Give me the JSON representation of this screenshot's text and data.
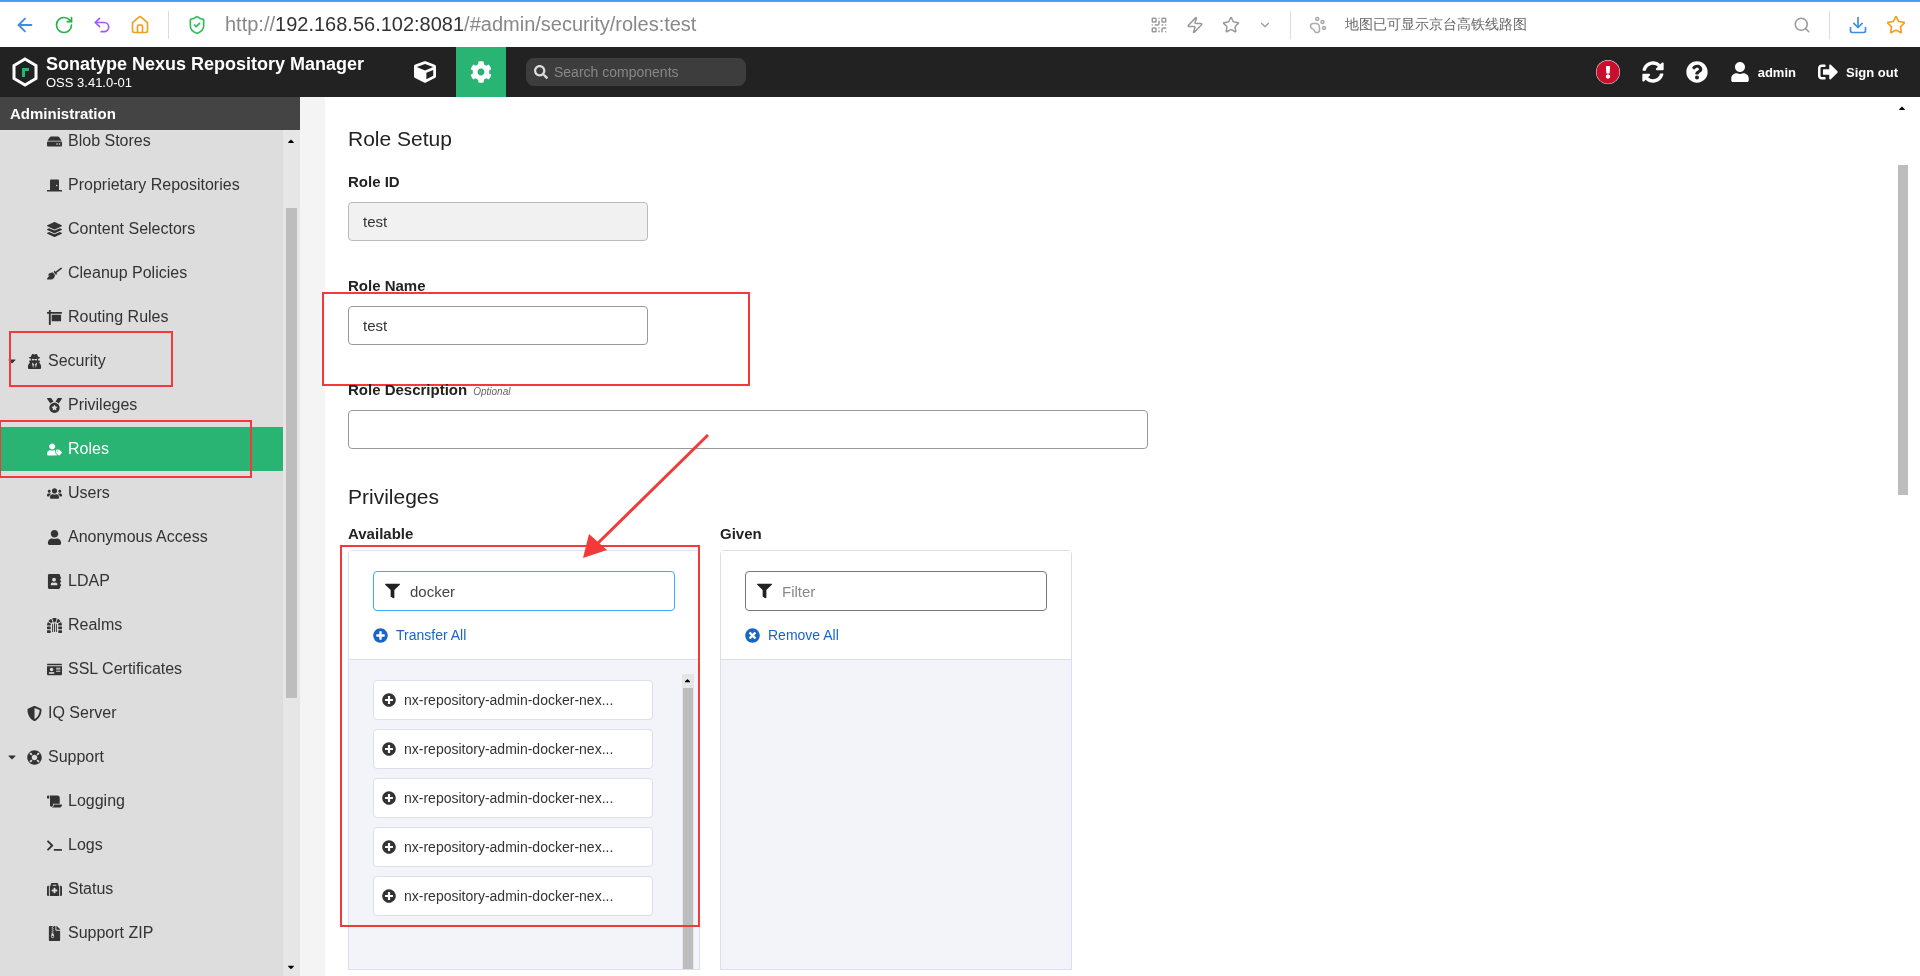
{
  "browser": {
    "url_scheme": "http://",
    "url_host": "192.168.56.102:8081",
    "url_path": "/#admin/security/roles:test",
    "news": "地图已可显示京台高铁线路图"
  },
  "header": {
    "product": "Sonatype Nexus Repository Manager",
    "version": "OSS 3.41.0-01",
    "modes": [
      {
        "kind": "browse",
        "selected": false
      },
      {
        "kind": "admin",
        "selected": true
      }
    ],
    "search_placeholder": "Search components",
    "user": "admin",
    "signout": "Sign out"
  },
  "sidebar": {
    "title": "Administration",
    "sections": [
      {
        "children": [
          {
            "label": "Blob Stores",
            "selected": false,
            "highlighted": false
          },
          {
            "label": "Proprietary Repositories",
            "selected": false,
            "highlighted": false
          },
          {
            "label": "Content Selectors",
            "selected": false,
            "highlighted": false
          },
          {
            "label": "Cleanup Policies",
            "selected": false,
            "highlighted": false
          },
          {
            "label": "Routing Rules",
            "selected": false,
            "highlighted": false
          }
        ]
      },
      {
        "label": "Security",
        "expanded": true,
        "selected": false,
        "highlighted": true,
        "children": [
          {
            "label": "Privileges",
            "selected": false,
            "highlighted": false
          },
          {
            "label": "Roles",
            "selected": true,
            "highlighted": true
          },
          {
            "label": "Users",
            "selected": false,
            "highlighted": false
          },
          {
            "label": "Anonymous Access",
            "selected": false,
            "highlighted": false
          },
          {
            "label": "LDAP",
            "selected": false,
            "highlighted": false
          },
          {
            "label": "Realms",
            "selected": false,
            "highlighted": false
          },
          {
            "label": "SSL Certificates",
            "selected": false,
            "highlighted": false
          }
        ]
      },
      {
        "label": "IQ Server",
        "selected": false,
        "highlighted": false
      },
      {
        "label": "Support",
        "expanded": true,
        "selected": false,
        "highlighted": false,
        "children": [
          {
            "label": "Logging",
            "selected": false,
            "highlighted": false
          },
          {
            "label": "Logs",
            "selected": false,
            "highlighted": false
          },
          {
            "label": "Status",
            "selected": false,
            "highlighted": false
          },
          {
            "label": "Support ZIP",
            "selected": false,
            "highlighted": false
          }
        ]
      }
    ]
  },
  "form": {
    "title": "Role Setup",
    "fields": [
      {
        "label": "Role ID",
        "value": "test",
        "disabled": true,
        "wide": false,
        "highlighted": false
      },
      {
        "label": "Role Name",
        "value": "test",
        "disabled": false,
        "wide": false,
        "highlighted": true
      },
      {
        "label": "Role Description",
        "optional": "Optional",
        "disabled": false,
        "wide": true,
        "highlighted": false
      }
    ],
    "privileges": {
      "title": "Privileges",
      "available": {
        "label": "Available",
        "filter_value": "docker",
        "focused": true,
        "highlighted": true,
        "action": "Transfer All",
        "items": [
          "nx-repository-admin-docker-nex...",
          "nx-repository-admin-docker-nex...",
          "nx-repository-admin-docker-nex...",
          "nx-repository-admin-docker-nex...",
          "nx-repository-admin-docker-nex..."
        ]
      },
      "given": {
        "label": "Given",
        "filter_placeholder": "Filter",
        "focused": false,
        "highlighted": false,
        "action": "Remove All"
      }
    }
  }
}
